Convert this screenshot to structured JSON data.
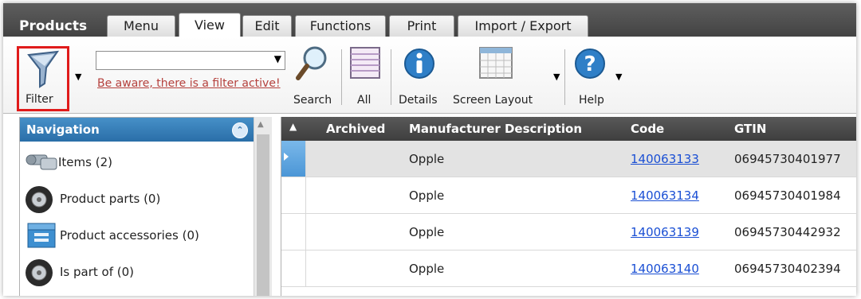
{
  "app": {
    "title": "Products"
  },
  "tabs": [
    {
      "label": "Menu"
    },
    {
      "label": "View"
    },
    {
      "label": "Edit"
    },
    {
      "label": "Functions"
    },
    {
      "label": "Print"
    },
    {
      "label": "Import / Export"
    }
  ],
  "toolbar": {
    "filter_label": "Filter",
    "filter_combo_value": "",
    "filter_warning": "Be aware, there is a filter active!",
    "search_label": "Search",
    "all_label": "All",
    "details_label": "Details",
    "screen_layout_label": "Screen Layout",
    "help_label": "Help"
  },
  "navigation": {
    "title": "Navigation",
    "items": [
      {
        "label": "Items (2)",
        "icon": "bolts-icon"
      },
      {
        "label": "Product parts (0)",
        "icon": "tire-icon"
      },
      {
        "label": "Product accessories (0)",
        "icon": "accessories-box-icon"
      },
      {
        "label": "Is part of (0)",
        "icon": "tire-icon"
      }
    ]
  },
  "grid": {
    "columns": [
      "Archived",
      "Manufacturer Description",
      "Code",
      "GTIN"
    ],
    "rows": [
      {
        "archived": "",
        "manufacturer": "Opple",
        "code": "140063133",
        "gtin": "06945730401977"
      },
      {
        "archived": "",
        "manufacturer": "Opple",
        "code": "140063134",
        "gtin": "06945730401984"
      },
      {
        "archived": "",
        "manufacturer": "Opple",
        "code": "140063139",
        "gtin": "06945730442932"
      },
      {
        "archived": "",
        "manufacturer": "Opple",
        "code": "140063140",
        "gtin": "06945730402394"
      }
    ]
  },
  "colors": {
    "highlight_border": "#e01b1b",
    "nav_header": "#2a6ea8",
    "link": "#1a4fd4",
    "warning_text": "#b5413d"
  }
}
